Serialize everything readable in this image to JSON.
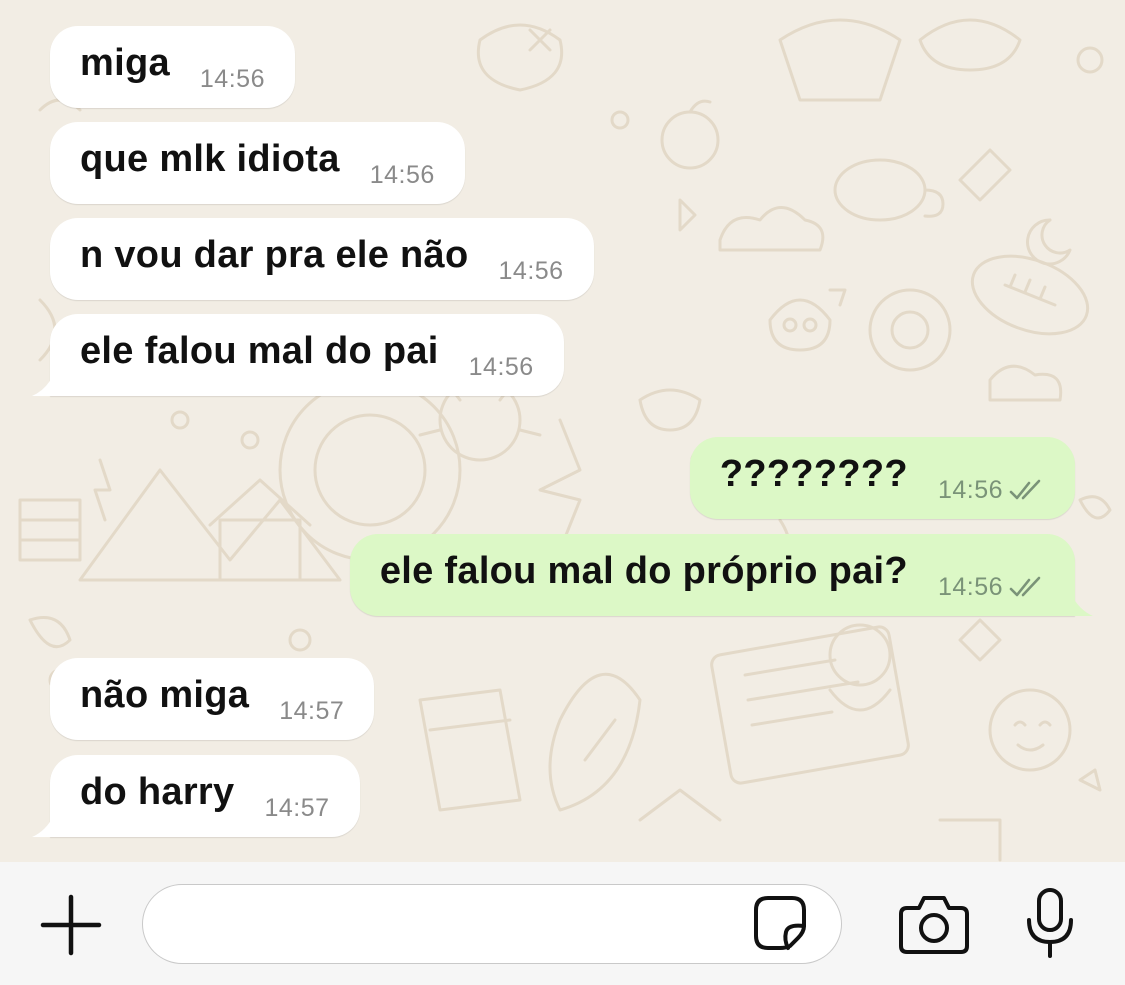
{
  "messages": [
    {
      "text": "miga",
      "time": "14:56"
    },
    {
      "text": "que mlk idiota",
      "time": "14:56"
    },
    {
      "text": "n vou dar pra ele não",
      "time": "14:56"
    },
    {
      "text": "ele falou mal do pai",
      "time": "14:56"
    },
    {
      "text": "????????",
      "time": "14:56",
      "status": "read-double-check"
    },
    {
      "text": "ele falou mal do próprio pai?",
      "time": "14:56",
      "status": "read-double-check"
    },
    {
      "text": "não miga",
      "time": "14:57"
    },
    {
      "text": "do harry",
      "time": "14:57"
    }
  ],
  "composer": {
    "input_value": "",
    "placeholder": "",
    "icons": [
      "plus-icon",
      "sticker-icon",
      "camera-icon",
      "microphone-icon"
    ]
  },
  "colors": {
    "incoming_bubble": "#ffffff",
    "outgoing_bubble": "#dcf8c6",
    "chat_background": "#f2ede4",
    "tick_color": "#7a9378"
  }
}
